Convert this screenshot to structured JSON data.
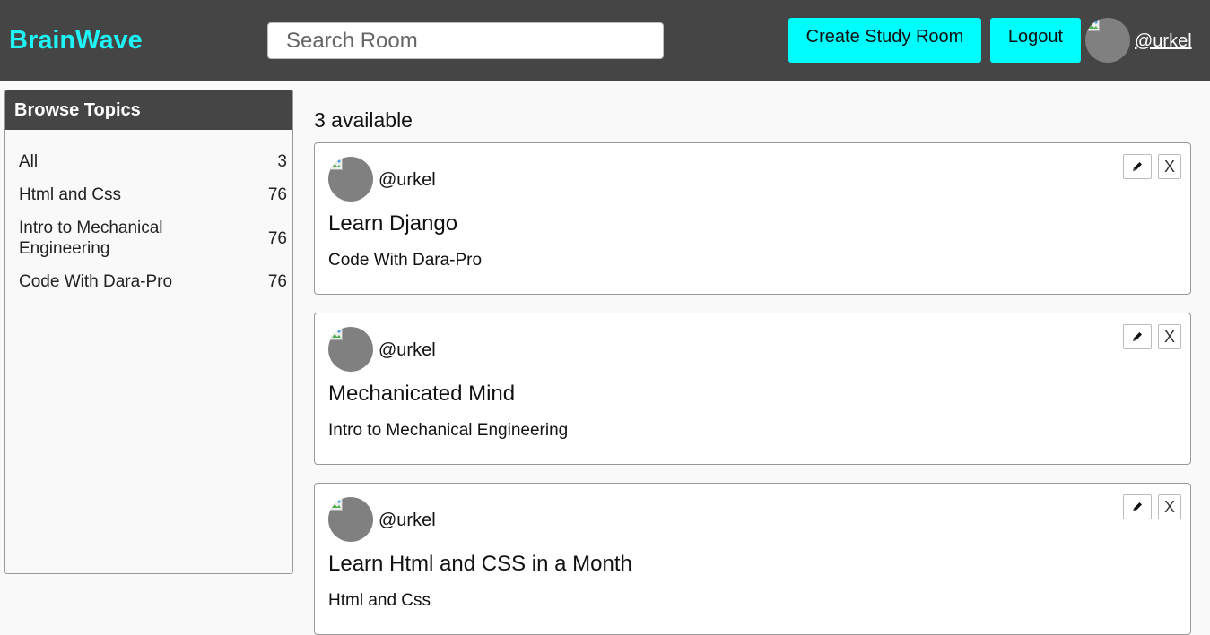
{
  "header": {
    "logo": "BrainWave",
    "search_placeholder": "Search Room",
    "create_label": "Create Study Room",
    "logout_label": "Logout",
    "username": "@urkel"
  },
  "sidebar": {
    "title": "Browse Topics",
    "topics": [
      {
        "name": "All",
        "count": "3"
      },
      {
        "name": "Html and Css",
        "count": "76"
      },
      {
        "name": "Intro to Mechanical Engineering",
        "count": "76"
      },
      {
        "name": "Code With Dara-Pro",
        "count": "76"
      }
    ]
  },
  "main": {
    "available": "3 available",
    "rooms": [
      {
        "user": "@urkel",
        "title": "Learn Django",
        "topic": "Code With Dara-Pro",
        "delete_label": "X"
      },
      {
        "user": "@urkel",
        "title": "Mechanicated Mind",
        "topic": "Intro to Mechanical Engineering",
        "delete_label": "X"
      },
      {
        "user": "@urkel",
        "title": "Learn Html and CSS in a Month",
        "topic": "Html and Css",
        "delete_label": "X"
      }
    ]
  },
  "icons": {
    "edit": "pencil-icon",
    "broken_image": "broken-image-icon"
  }
}
